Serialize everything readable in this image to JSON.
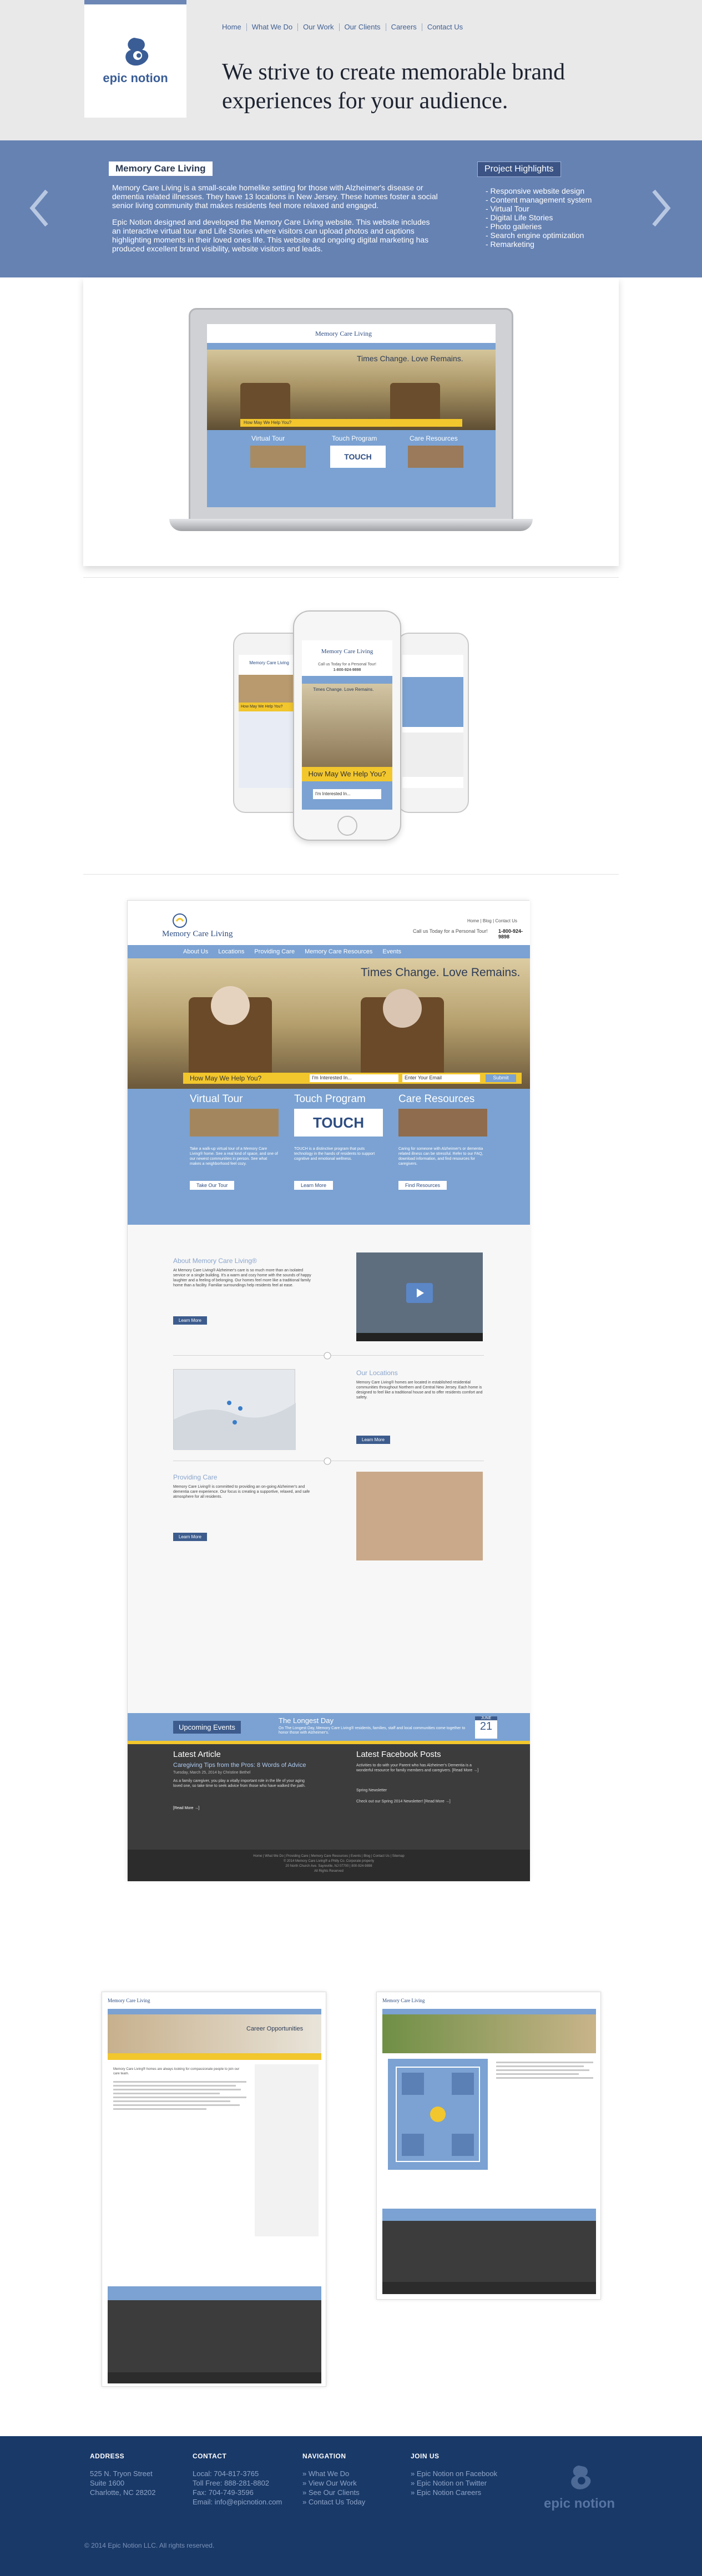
{
  "header": {
    "logo_text": "epic notion",
    "nav": [
      "Home",
      "What We Do",
      "Our Work",
      "Our Clients",
      "Careers",
      "Contact Us"
    ],
    "tagline": "We strive to create memorable brand experiences for your audience."
  },
  "project": {
    "title": "Memory Care Living",
    "description": [
      "Memory Care Living is a small-scale homelike setting for those with Alzheimer's disease or dementia related illnesses. They have 13 locations in New Jersey. These homes foster a social senior living community that makes residents feel more relaxed and engaged.",
      "Epic Notion designed and developed the Memory Care Living website. This website includes an interactive virtual tour and Life Stories where visitors can upload photos and captions highlighting moments in their loved ones life. This website and ongoing digital marketing has produced excellent brand visibility, website visitors and leads."
    ],
    "highlights_title": "Project Highlights",
    "highlights": [
      "- Responsive website design",
      "- Content management system",
      "- Virtual Tour",
      "- Digital Life Stories",
      "- Photo galleries",
      "- Search engine optimization",
      "- Remarketing"
    ]
  },
  "mock_site": {
    "brand": "Memory Care Living",
    "utility_links": "Home | Blog | Contact Us",
    "call_text": "Call us Today for a Personal Tour!",
    "phone": "1-800-924-9898",
    "nav": [
      "About Us",
      "Locations",
      "Providing Care",
      "Memory Care Resources",
      "Events"
    ],
    "hero_heading": "Times Change. Love Remains.",
    "help_label": "How May We Help You?",
    "select_text": "I'm Interested In...",
    "email_placeholder": "Enter Your Email",
    "submit": "Submit",
    "features": [
      {
        "title": "Virtual Tour",
        "button": "Take Our Tour",
        "text": "Take a walk-up virtual tour of a Memory Care Living® home. See a real kind of space, and one of our newest communities in person. See what makes a neighborhood feel cozy."
      },
      {
        "title": "Touch Program",
        "button": "Learn More",
        "text": "TOUCH is a distinctive program that puts technology in the hands of residents to support cognitive and emotional wellness."
      },
      {
        "title": "Care Resources",
        "button": "Find Resources",
        "text": "Caring for someone with Alzheimer's or dementia related illness can be stressful. Refer to our FAQ, download information, and find resources for caregivers."
      }
    ],
    "touch_logo": "TOUCH",
    "about_heading": "About Memory Care Living®",
    "about_text": "At Memory Care Living® Alzheimer's care is so much more than an isolated service or a single building. It's a warm and cozy home with the sounds of happy laughter and a feeling of belonging. Our homes feel more like a traditional family home than a facility. Familiar surroundings help residents feel at ease.",
    "about_button": "Learn More",
    "locations_heading": "Our Locations",
    "locations_text": "Memory Care Living® homes are located in established residential communities throughout Northern and Central New Jersey. Each home is designed to feel like a traditional house and to offer residents comfort and safety.",
    "locations_button": "Learn More",
    "care_heading": "Providing Care",
    "care_text": "Memory Care Living® is committed to providing an on-going Alzheimer's and dementia care experience. Our focus is creating a supportive, relaxed, and safe atmosphere for all residents.",
    "care_button": "Learn More",
    "events_label": "Upcoming Events",
    "event_title": "The Longest Day",
    "event_text": "On The Longest Day, Memory Care Living® residents, families, staff and local communities come together to honor those with Alzheimer's.",
    "event_month": "JUNE",
    "event_day": "21",
    "article_heading": "Latest Article",
    "article_title": "Caregiving Tips from the Pros: 8 Words of Advice",
    "article_meta": "Tuesday, March 25, 2014 by Christine Bethel",
    "article_text": "As a family caregiver, you play a vitally important role in the life of your aging loved one, so take time to seek advice from those who have walked the path.",
    "article_link": "[Read More →]",
    "facebook_heading": "Latest Facebook Posts",
    "facebook_posts": [
      "Activities to do with your Parent who has Alzheimer's Dementia is a wonderful resource for family members and caregivers. [Read More →]",
      "Spring Newsletter",
      "Check out our Spring 2014 Newsletter! [Read More →]"
    ],
    "footer_links": "Home | What We Do | Providing Care | Memory Care Resources | Events | Blog | Contact Us | Sitemap",
    "footer_copy": "© 2014 Memory Care Living® a Philly Co. Corporate property",
    "footer_address": "20 North Church Ave. Sayreville, NJ 07700 | 800-924-9898",
    "footer_rights": "All Rights Reserved",
    "careers_heading": "Career Opportunities",
    "careers_text": "Memory Care Living® homes are always looking for compassionate people to join our care team."
  },
  "footer": {
    "address_heading": "ADDRESS",
    "address": [
      "525 N. Tryon Street",
      "Suite 1600",
      "Charlotte, NC 28202"
    ],
    "contact_heading": "CONTACT",
    "contact": [
      "Local: 704-817-3765",
      "Toll Free: 888-281-8802",
      "Fax: 704-749-3596",
      "Email: info@epicnotion.com"
    ],
    "navigation_heading": "NAVIGATION",
    "navigation": [
      "» What We Do",
      "» View Our Work",
      "» See Our Clients",
      "» Contact Us Today"
    ],
    "join_heading": "JOIN US",
    "join": [
      "» Epic Notion on Facebook",
      "» Epic Notion on Twitter",
      "» Epic Notion Careers"
    ],
    "copyright": "© 2014 Epic Notion LLC. All rights reserved.",
    "logo_text": "epic notion"
  },
  "colors": {
    "brand_blue": "#193968",
    "band_blue": "#6682b3",
    "mcl_blue": "#7ba2d2",
    "mcl_yellow": "#f2c62d"
  }
}
